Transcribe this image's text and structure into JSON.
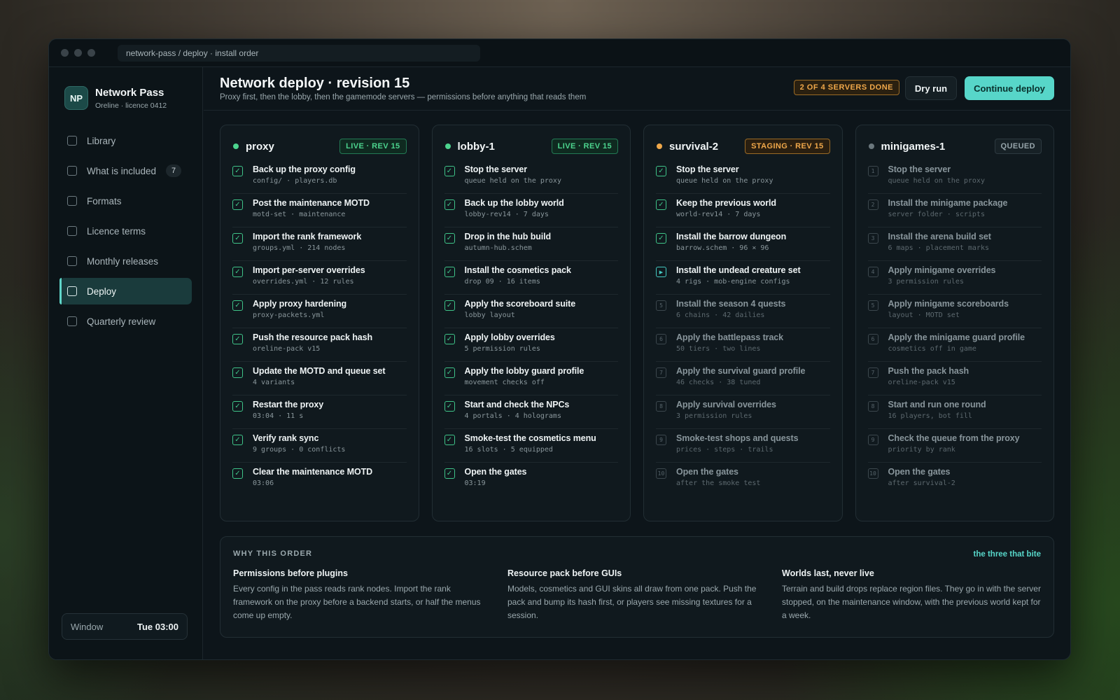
{
  "url": "network-pass / deploy · install order",
  "brand": {
    "logo": "NP",
    "name": "Network Pass",
    "sub": "Oreline · licence 0412"
  },
  "nav": [
    {
      "label": "Library"
    },
    {
      "label": "What is included",
      "badge": "7"
    },
    {
      "label": "Formats"
    },
    {
      "label": "Licence terms"
    },
    {
      "label": "Monthly releases"
    },
    {
      "label": "Deploy",
      "active": true
    },
    {
      "label": "Quarterly review"
    }
  ],
  "window": {
    "label": "Window",
    "time": "Tue 03:00"
  },
  "header": {
    "title": "Network deploy · revision 15",
    "subtitle": "Proxy first, then the lobby, then the gamemode servers — permissions before anything that reads them",
    "progress": "2 OF 4 SERVERS DONE",
    "dry_run": "Dry run",
    "continue": "Continue deploy"
  },
  "colors": {
    "accent": "#57d6c9",
    "live": "#4cd48e",
    "staging": "#f0a84a",
    "queued": "#6b777d"
  },
  "servers": [
    {
      "name": "proxy",
      "badge": "LIVE · REV 15",
      "status": "live",
      "steps": [
        {
          "n": "1",
          "title": "Back up the proxy config",
          "meta": "config/ · players.db",
          "state": "done"
        },
        {
          "n": "2",
          "title": "Post the maintenance MOTD",
          "meta": "motd-set · maintenance",
          "state": "done"
        },
        {
          "n": "3",
          "title": "Import the rank framework",
          "meta": "groups.yml · 214 nodes",
          "state": "done"
        },
        {
          "n": "4",
          "title": "Import per-server overrides",
          "meta": "overrides.yml · 12 rules",
          "state": "done"
        },
        {
          "n": "5",
          "title": "Apply proxy hardening",
          "meta": "proxy-packets.yml",
          "state": "done"
        },
        {
          "n": "6",
          "title": "Push the resource pack hash",
          "meta": "oreline-pack v15",
          "state": "done"
        },
        {
          "n": "7",
          "title": "Update the MOTD and queue set",
          "meta": "4 variants",
          "state": "done"
        },
        {
          "n": "8",
          "title": "Restart the proxy",
          "meta": "03:04 · 11 s",
          "state": "done"
        },
        {
          "n": "9",
          "title": "Verify rank sync",
          "meta": "9 groups · 0 conflicts",
          "state": "done"
        },
        {
          "n": "10",
          "title": "Clear the maintenance MOTD",
          "meta": "03:06",
          "state": "done"
        }
      ]
    },
    {
      "name": "lobby-1",
      "badge": "LIVE · REV 15",
      "status": "live",
      "steps": [
        {
          "n": "1",
          "title": "Stop the server",
          "meta": "queue held on the proxy",
          "state": "done"
        },
        {
          "n": "2",
          "title": "Back up the lobby world",
          "meta": "lobby-rev14 · 7 days",
          "state": "done"
        },
        {
          "n": "3",
          "title": "Drop in the hub build",
          "meta": "autumn-hub.schem",
          "state": "done"
        },
        {
          "n": "4",
          "title": "Install the cosmetics pack",
          "meta": "drop 09 · 16 items",
          "state": "done"
        },
        {
          "n": "5",
          "title": "Apply the scoreboard suite",
          "meta": "lobby layout",
          "state": "done"
        },
        {
          "n": "6",
          "title": "Apply lobby overrides",
          "meta": "5 permission rules",
          "state": "done"
        },
        {
          "n": "7",
          "title": "Apply the lobby guard profile",
          "meta": "movement checks off",
          "state": "done"
        },
        {
          "n": "8",
          "title": "Start and check the NPCs",
          "meta": "4 portals · 4 holograms",
          "state": "done"
        },
        {
          "n": "9",
          "title": "Smoke-test the cosmetics menu",
          "meta": "16 slots · 5 equipped",
          "state": "done"
        },
        {
          "n": "10",
          "title": "Open the gates",
          "meta": "03:19",
          "state": "done"
        }
      ]
    },
    {
      "name": "survival-2",
      "badge": "STAGING · REV 15",
      "status": "staging",
      "steps": [
        {
          "n": "1",
          "title": "Stop the server",
          "meta": "queue held on the proxy",
          "state": "done"
        },
        {
          "n": "2",
          "title": "Keep the previous world",
          "meta": "world-rev14 · 7 days",
          "state": "done"
        },
        {
          "n": "3",
          "title": "Install the barrow dungeon",
          "meta": "barrow.schem · 96 × 96",
          "state": "done"
        },
        {
          "n": "4",
          "title": "Install the undead creature set",
          "meta": "4 rigs · mob-engine configs",
          "state": "running"
        },
        {
          "n": "5",
          "title": "Install the season 4 quests",
          "meta": "6 chains · 42 dailies",
          "state": "todo"
        },
        {
          "n": "6",
          "title": "Apply the battlepass track",
          "meta": "50 tiers · two lines",
          "state": "todo"
        },
        {
          "n": "7",
          "title": "Apply the survival guard profile",
          "meta": "46 checks · 38 tuned",
          "state": "todo"
        },
        {
          "n": "8",
          "title": "Apply survival overrides",
          "meta": "3 permission rules",
          "state": "todo"
        },
        {
          "n": "9",
          "title": "Smoke-test shops and quests",
          "meta": "prices · steps · trails",
          "state": "todo"
        },
        {
          "n": "10",
          "title": "Open the gates",
          "meta": "after the smoke test",
          "state": "todo"
        }
      ]
    },
    {
      "name": "minigames-1",
      "badge": "QUEUED",
      "status": "queued",
      "steps": [
        {
          "n": "1",
          "title": "Stop the server",
          "meta": "queue held on the proxy",
          "state": "todo"
        },
        {
          "n": "2",
          "title": "Install the minigame package",
          "meta": "server folder · scripts",
          "state": "todo"
        },
        {
          "n": "3",
          "title": "Install the arena build set",
          "meta": "6 maps · placement marks",
          "state": "todo"
        },
        {
          "n": "4",
          "title": "Apply minigame overrides",
          "meta": "3 permission rules",
          "state": "todo"
        },
        {
          "n": "5",
          "title": "Apply minigame scoreboards",
          "meta": "layout · MOTD set",
          "state": "todo"
        },
        {
          "n": "6",
          "title": "Apply the minigame guard profile",
          "meta": "cosmetics off in game",
          "state": "todo"
        },
        {
          "n": "7",
          "title": "Push the pack hash",
          "meta": "oreline-pack v15",
          "state": "todo"
        },
        {
          "n": "8",
          "title": "Start and run one round",
          "meta": "16 players, bot fill",
          "state": "todo"
        },
        {
          "n": "9",
          "title": "Check the queue from the proxy",
          "meta": "priority by rank",
          "state": "todo"
        },
        {
          "n": "10",
          "title": "Open the gates",
          "meta": "after survival-2",
          "state": "todo"
        }
      ]
    }
  ],
  "why": {
    "label": "WHY THIS ORDER",
    "link": "the three that bite",
    "items": [
      {
        "title": "Permissions before plugins",
        "text": "Every config in the pass reads rank nodes. Import the rank framework on the proxy before a backend starts, or half the menus come up empty."
      },
      {
        "title": "Resource pack before GUIs",
        "text": "Models, cosmetics and GUI skins all draw from one pack. Push the pack and bump its hash first, or players see missing textures for a session."
      },
      {
        "title": "Worlds last, never live",
        "text": "Terrain and build drops replace region files. They go in with the server stopped, on the maintenance window, with the previous world kept for a week."
      }
    ]
  }
}
